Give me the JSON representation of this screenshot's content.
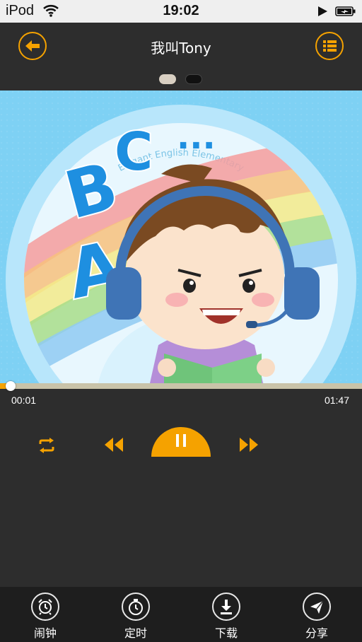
{
  "status_bar": {
    "carrier": "iPod",
    "time": "19:02"
  },
  "header": {
    "title": "我叫Tony"
  },
  "artwork": {
    "badge_text": "Elegant English Elementary",
    "letters": [
      "A",
      "B",
      "C",
      "..."
    ]
  },
  "player": {
    "current_time": "00:01",
    "total_time": "01:47",
    "progress": 0.03
  },
  "colors": {
    "accent": "#f5a200",
    "background": "#2d2d2d",
    "tab_bar": "#1e1e1e"
  },
  "tabs": [
    {
      "label": "闹钟",
      "icon": "alarm-clock-icon"
    },
    {
      "label": "定时",
      "icon": "stopwatch-icon"
    },
    {
      "label": "下载",
      "icon": "download-icon"
    },
    {
      "label": "分享",
      "icon": "share-icon"
    }
  ]
}
